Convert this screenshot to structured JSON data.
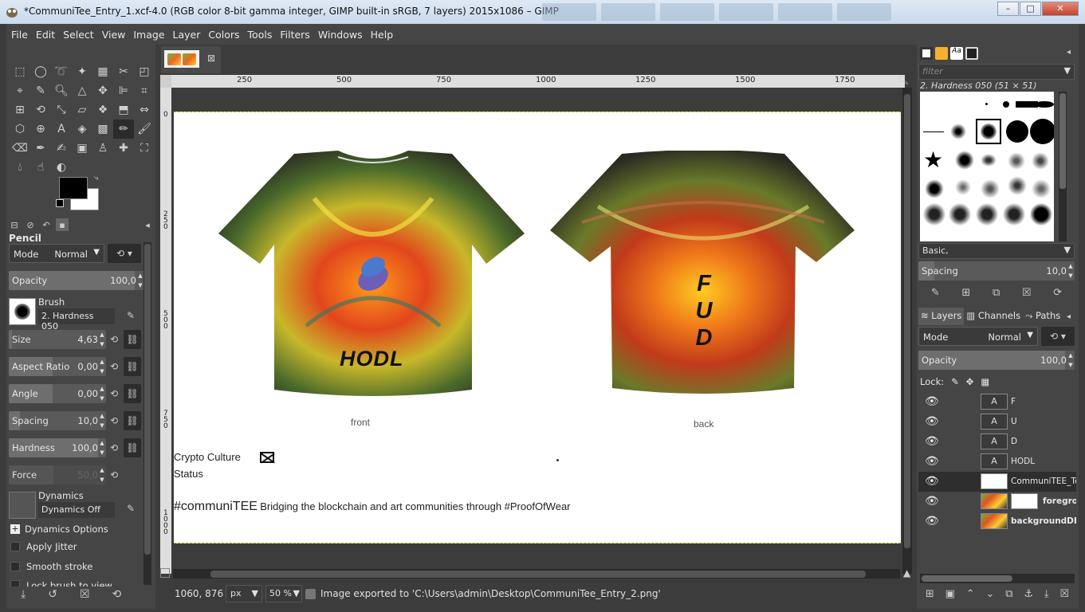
{
  "window": {
    "title": "*CommuniTee_Entry_1.xcf-4.0 (RGB color 8-bit gamma integer, GIMP built-in sRGB, 7 layers) 2015x1086 – GIMP",
    "minimize": "–",
    "maximize": "□",
    "close": "✕"
  },
  "menu": [
    "File",
    "Edit",
    "Select",
    "View",
    "Image",
    "Layer",
    "Colors",
    "Tools",
    "Filters",
    "Windows",
    "Help"
  ],
  "tool_options": {
    "tool_name": "Pencil",
    "mode_label": "Mode",
    "mode_value": "Normal",
    "opacity_label": "Opacity",
    "opacity_value": "100,0",
    "brush_label": "Brush",
    "brush_value": "2. Hardness 050",
    "size_label": "Size",
    "size_value": "4,63",
    "aspect_label": "Aspect Ratio",
    "aspect_value": "0,00",
    "angle_label": "Angle",
    "angle_value": "0,00",
    "spacing_label": "Spacing",
    "spacing_value": "10,0",
    "hardness_label": "Hardness",
    "hardness_value": "100,0",
    "force_label": "Force",
    "force_value": "50,0",
    "dynamics_label": "Dynamics",
    "dynamics_value": "Dynamics Off",
    "dynamics_options": "Dynamics Options",
    "apply_jitter": "Apply Jitter",
    "smooth_stroke": "Smooth stroke",
    "lock_brush": "Lock brush to view"
  },
  "canvas": {
    "ruler_labels": [
      "250",
      "500",
      "750",
      "1000",
      "1250",
      "1500",
      "1750"
    ],
    "vruler_labels": [
      "0",
      "250",
      "500",
      "750",
      "1000"
    ],
    "front_label": "front",
    "back_label": "back",
    "hodl_text": "HODL",
    "fud_letters": [
      "F",
      "U",
      "D"
    ],
    "crypto_culture": "Crypto Culture",
    "status": "Status",
    "hashtag": "#communiTEE",
    "tagline": "Bridging the blockchain and art communities through #ProofOfWear"
  },
  "statusbar": {
    "coords": "1060, 876",
    "unit": "px",
    "zoom": "50 %",
    "message": "Image exported to 'C:\\Users\\admin\\Desktop\\CommuniTee_Entry_2.png'"
  },
  "brushes": {
    "filter_placeholder": "filter",
    "current": "2. Hardness 050 (51 × 51)",
    "set": "Basic,",
    "spacing_label": "Spacing",
    "spacing_value": "10,0"
  },
  "layers_panel": {
    "tabs": [
      "Layers",
      "Channels",
      "Paths"
    ],
    "mode_label": "Mode",
    "mode_value": "Normal",
    "opacity_label": "Opacity",
    "opacity_value": "100,0",
    "lock_label": "Lock:",
    "layers": [
      {
        "name": "F",
        "kind": "text"
      },
      {
        "name": "U",
        "kind": "text"
      },
      {
        "name": "D",
        "kind": "text"
      },
      {
        "name": "HODL",
        "kind": "text"
      },
      {
        "name": "CommuniTEE_Temp",
        "kind": "white"
      },
      {
        "name": "foreground",
        "kind": "mask"
      },
      {
        "name": "backgroundDE",
        "kind": "img"
      }
    ]
  },
  "colors": {
    "foreground": "#000000",
    "background": "#ffffff",
    "accent": "#c8c800"
  }
}
